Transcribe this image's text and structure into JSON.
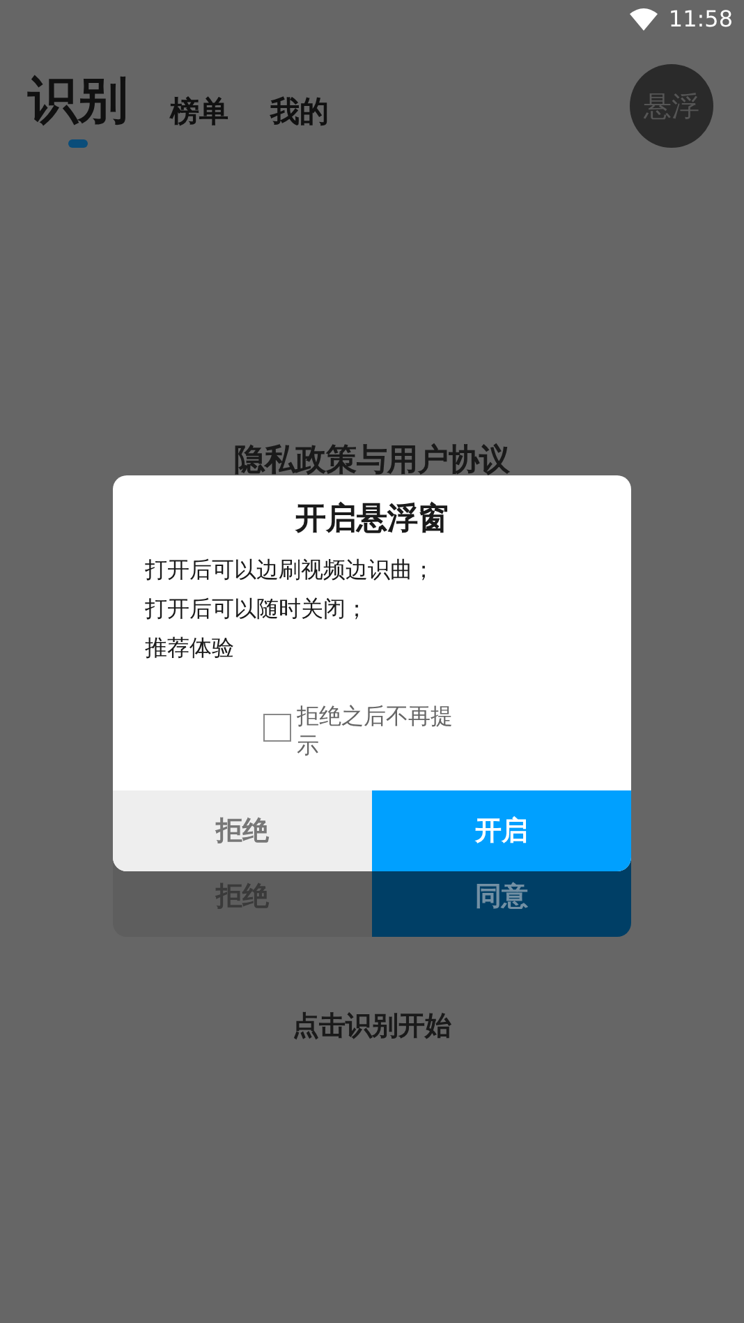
{
  "status_bar": {
    "time": "11:58"
  },
  "tabs": [
    {
      "label": "识别",
      "selected": true
    },
    {
      "label": "榜单",
      "selected": false
    },
    {
      "label": "我的",
      "selected": false
    }
  ],
  "float_button": {
    "label": "悬浮"
  },
  "privacy_dialog": {
    "title": "隐私政策与用户协议",
    "buttons": [
      {
        "label": "拒绝",
        "kind": "secondary"
      },
      {
        "label": "同意",
        "kind": "primary"
      }
    ]
  },
  "float_dialog": {
    "title": "开启悬浮窗",
    "lines": [
      "打开后可以边刷视频边识曲；",
      "打开后可以随时关闭；",
      "推荐体验"
    ],
    "checkbox": {
      "label": "拒绝之后不再提示",
      "checked": false
    },
    "buttons": [
      {
        "label": "拒绝",
        "kind": "secondary"
      },
      {
        "label": "开启",
        "kind": "primary"
      }
    ]
  },
  "hint": "点击识别开始"
}
